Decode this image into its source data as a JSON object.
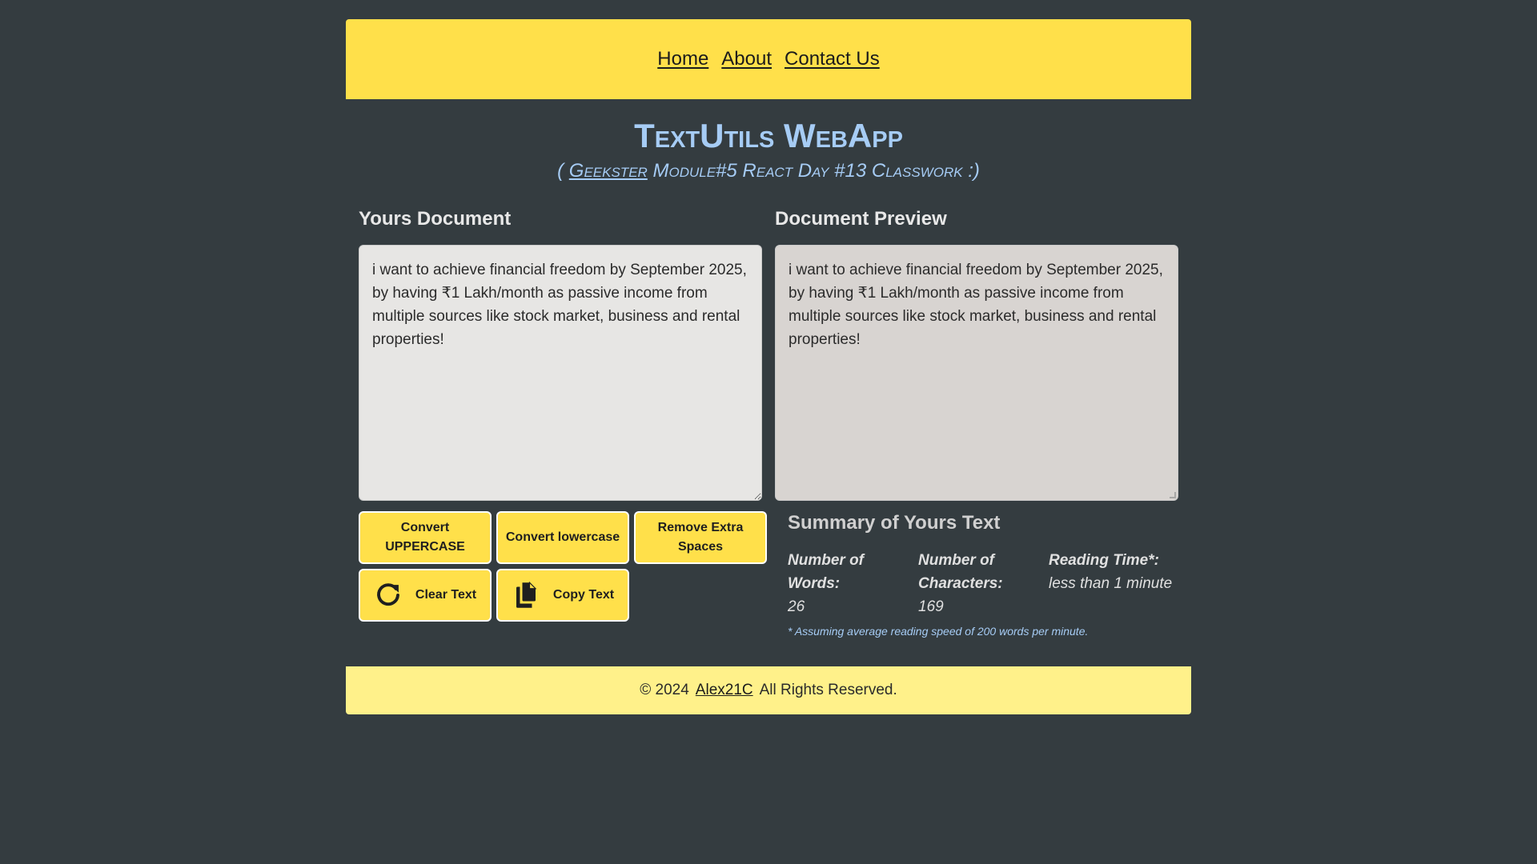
{
  "nav": {
    "links": [
      "Home",
      "About",
      "Contact Us"
    ]
  },
  "header": {
    "title": "TextUtils WebApp",
    "subtitle_prefix": "( ",
    "subtitle_link": "Geekster",
    "subtitle_rest": " Module#5 React Day #13 Classwork :)",
    "accent_color": "#a6ccf5"
  },
  "editor": {
    "heading": "Yours Document",
    "text": "i want to achieve financial freedom by September 2025, by having ₹1 Lakh/month as passive income from multiple sources like stock market, business and rental properties!"
  },
  "preview": {
    "heading": "Document Preview",
    "text": "i want to achieve financial freedom by September 2025, by having ₹1 Lakh/month as passive income from multiple sources like stock market, business and rental properties!"
  },
  "buttons": {
    "uppercase": "Convert UPPERCASE",
    "lowercase": "Convert lowercase",
    "remove_spaces": "Remove Extra Spaces",
    "clear": "Clear Text",
    "copy": "Copy Text",
    "color": "#ffe04a"
  },
  "summary": {
    "title": "Summary of Yours Text",
    "words_label": "Number of Words:",
    "words_value": "26",
    "chars_label": "Number of Characters:",
    "chars_value": "169",
    "reading_label": "Reading Time*:",
    "reading_value": "less than 1 minute",
    "footnote": "* Assuming average reading speed of 200 words per minute."
  },
  "footer": {
    "copyright": "© 2024",
    "author": "Alex21C",
    "rights": "All Rights Reserved.",
    "color": "#fff18a"
  },
  "colors": {
    "background": "#343c40",
    "nav": "#ffe04a"
  }
}
